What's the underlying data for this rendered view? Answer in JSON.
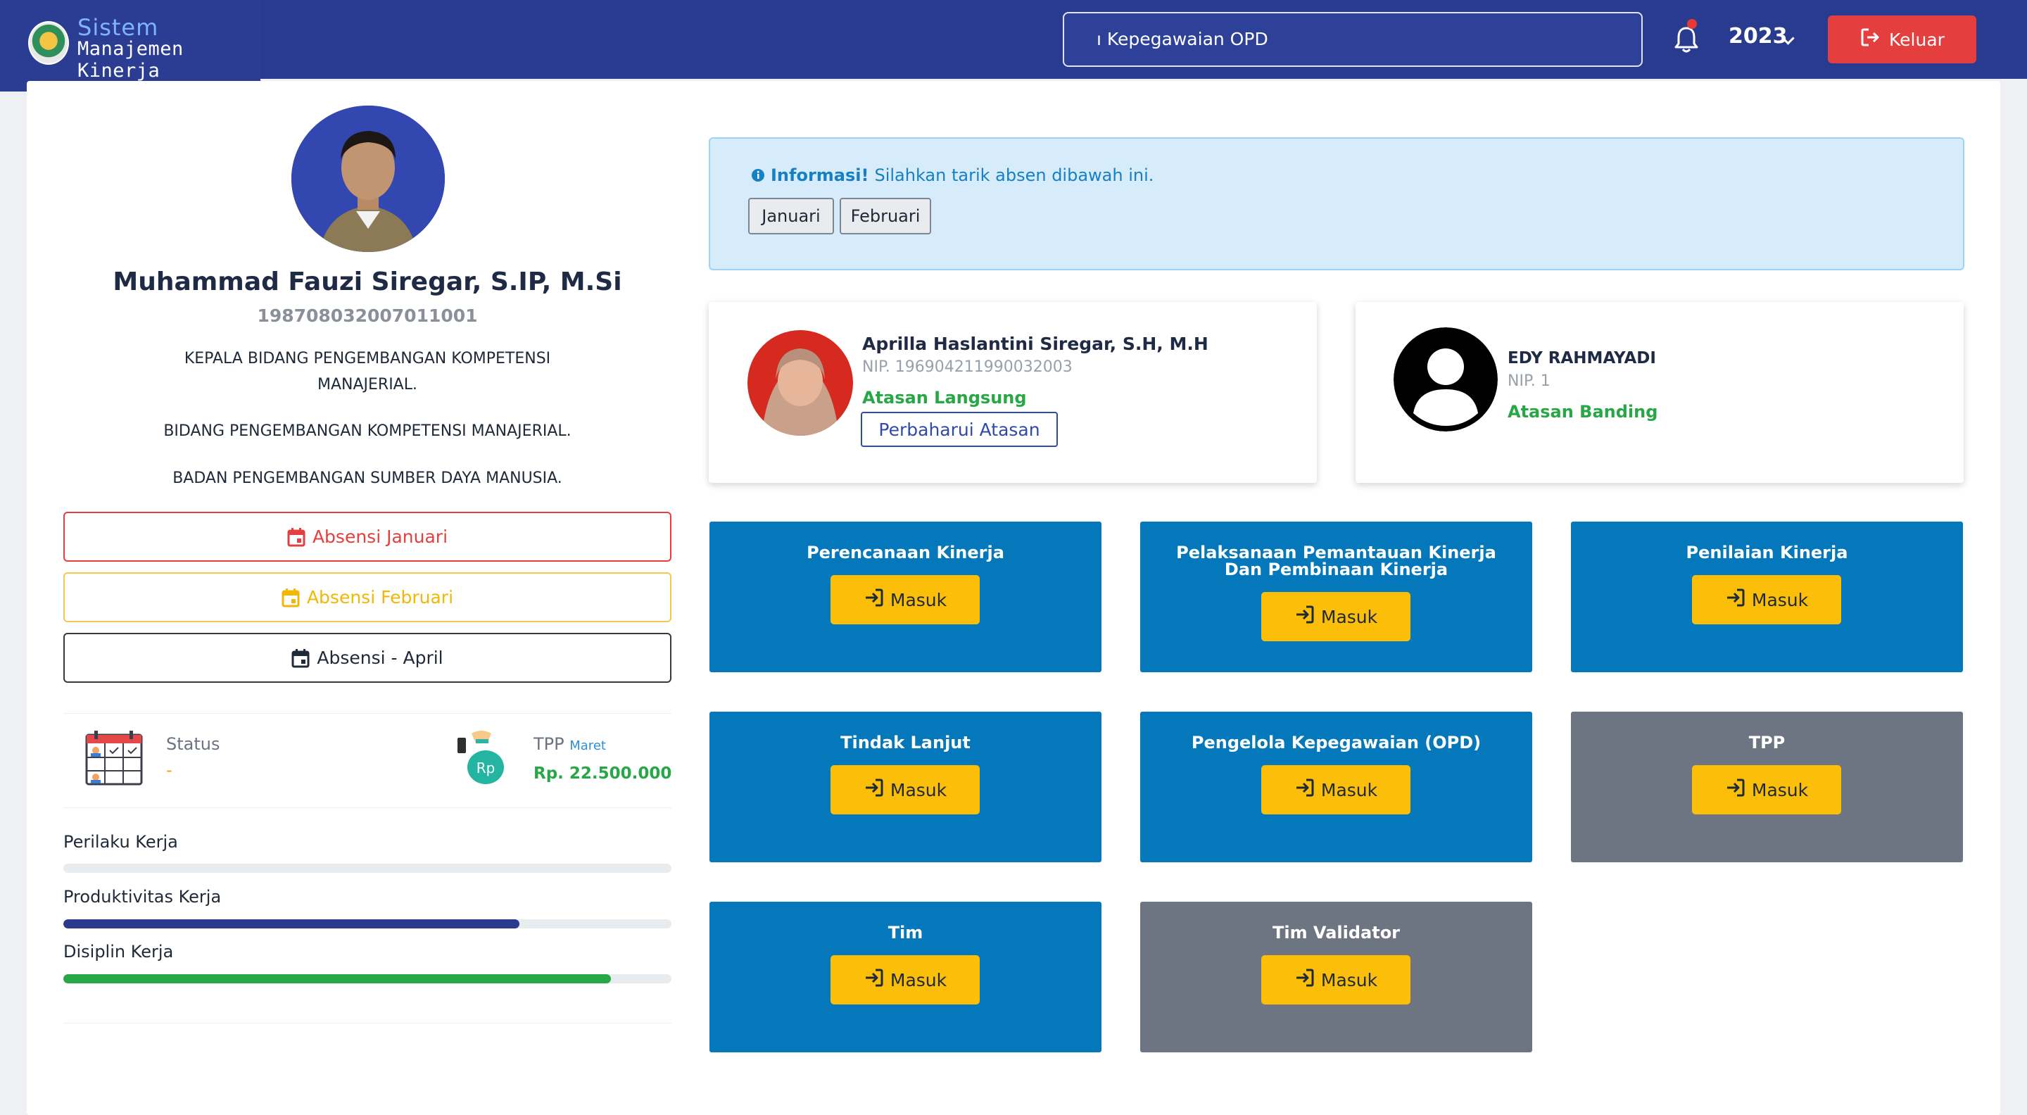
{
  "app": {
    "title_line1": "Sistem",
    "title_line2": "Manajemen Kinerja",
    "search_value": "ı Kepegawaian OPD",
    "year": "2023",
    "logout_label": "Keluar"
  },
  "profile": {
    "name": "Muhammad Fauzi Siregar, S.IP, M.Si",
    "nip": "198708032007011001",
    "position_line1": "KEPALA BIDANG PENGEMBANGAN KOMPETENSI",
    "position_line2": "MANAJERIAL.",
    "division": "BIDANG PENGEMBANGAN KOMPETENSI MANAJERIAL.",
    "agency": "BADAN PENGEMBANGAN SUMBER DAYA MANUSIA."
  },
  "attendance_buttons": [
    {
      "label": "Absensi Januari",
      "color": "#e53e3e"
    },
    {
      "label": "Absensi Februari",
      "color": "#f2b705"
    },
    {
      "label": "Absensi - April",
      "color": "#1f2937"
    }
  ],
  "stats": {
    "status_label": "Status",
    "status_value": "-",
    "tpp_label": "TPP",
    "tpp_month": "Maret",
    "tpp_value": "Rp. 22.500.000"
  },
  "progress": [
    {
      "label": "Perilaku Kerja",
      "value": 0,
      "color": "#2a3a8e"
    },
    {
      "label": "Produktivitas Kerja",
      "value": 75,
      "color": "#2a3a8e"
    },
    {
      "label": "Disiplin Kerja",
      "value": 90,
      "color": "#27a745"
    }
  ],
  "info": {
    "bold": "Informasi!",
    "text": "Silahkan tarik absen dibawah ini.",
    "months": [
      "Januari",
      "Februari"
    ]
  },
  "supervisors": [
    {
      "name": "Aprilla Haslantini Siregar, S.H, M.H",
      "nip": "NIP. 196904211990032003",
      "role": "Atasan Langsung",
      "update_label": "Perbaharui Atasan"
    },
    {
      "name": "EDY RAHMAYADI",
      "nip": "NIP. 1",
      "role": "Atasan Banding"
    }
  ],
  "tiles": [
    {
      "title_line1": "Perencanaan Kinerja",
      "title_line2": "",
      "button": "Masuk",
      "color": "#0478bb"
    },
    {
      "title_line1": "Pelaksanaan Pemantauan Kinerja",
      "title_line2": "Dan Pembinaan Kinerja",
      "button": "Masuk",
      "color": "#0478bb"
    },
    {
      "title_line1": "Penilaian Kinerja",
      "title_line2": "",
      "button": "Masuk",
      "color": "#0478bb"
    },
    {
      "title_line1": "Tindak Lanjut",
      "title_line2": "",
      "button": "Masuk",
      "color": "#0478bb"
    },
    {
      "title_line1": "Pengelola Kepegawaian (OPD)",
      "title_line2": "",
      "button": "Masuk",
      "color": "#0478bb"
    },
    {
      "title_line1": "TPP",
      "title_line2": "",
      "button": "Masuk",
      "color": "#6d7583"
    },
    {
      "title_line1": "Tim",
      "title_line2": "",
      "button": "Masuk",
      "color": "#0478bb"
    },
    {
      "title_line1": "Tim Validator",
      "title_line2": "",
      "button": "Masuk",
      "color": "#6d7583"
    }
  ]
}
